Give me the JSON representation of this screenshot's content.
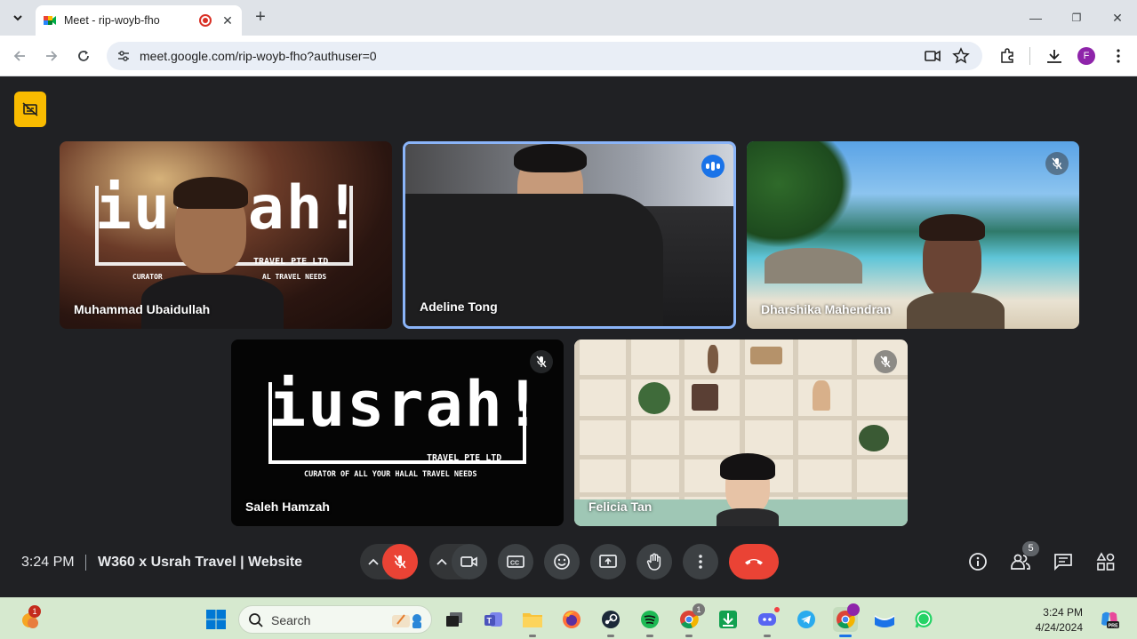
{
  "browser": {
    "tab_title": "Meet - rip-woyb-fho",
    "url": "meet.google.com/rip-woyb-fho?authuser=0",
    "profile_initial": "F"
  },
  "participants": [
    {
      "name": "Muhammad Ubaidullah",
      "muted": false
    },
    {
      "name": "Adeline Tong",
      "speaking": true
    },
    {
      "name": "Dharshika Mahendran",
      "muted": true
    },
    {
      "name": "Saleh Hamzah",
      "muted": true
    },
    {
      "name": "Felicia Tan",
      "muted": true
    }
  ],
  "logo": {
    "wordmark": "iusrah!",
    "company": "TRAVEL PTE LTD",
    "tagline_full": "Curator Of All Your Halal Travel Needs",
    "tagline_partial": "CURATOR",
    "tagline_partial_end": "AL TRAVEL NEEDS"
  },
  "meeting": {
    "time": "3:24 PM",
    "title": "W360 x Usrah Travel | Website",
    "participant_count": "5"
  },
  "taskbar": {
    "search_label": "Search",
    "weather_badge": "1",
    "chrome_badge": "1",
    "time": "3:24 PM",
    "date": "4/24/2024"
  },
  "colors": {
    "meet_bg": "#202124",
    "end_call": "#ea4335",
    "speaking_blue": "#1a73e8",
    "active_border": "#8ab4f8",
    "caption_badge": "#f9bb00",
    "taskbar_bg": "#d6e9cf"
  }
}
